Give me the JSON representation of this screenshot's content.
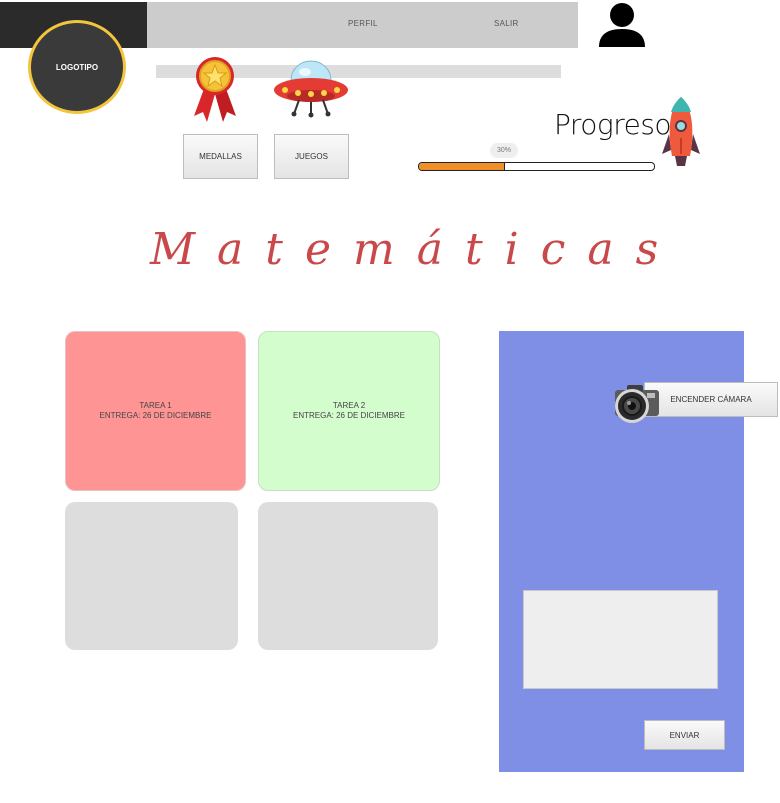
{
  "header": {
    "logo_text": "LOGOTIPO",
    "nav": {
      "profile": "PERFIL",
      "logout": "SALIR"
    }
  },
  "icons": {
    "user": "user-icon",
    "medal": "medal-icon",
    "ufo": "ufo-icon",
    "rocket": "rocket-icon",
    "camera": "camera-icon"
  },
  "buttons": {
    "medals": "MEDALLAS",
    "games": "JUEGOS"
  },
  "progress": {
    "title": "Progreso",
    "value_label": "30%",
    "value": 0.36
  },
  "subject": {
    "title": "Matemáticas"
  },
  "tasks": [
    {
      "title": "TAREA 1",
      "due": "ENTREGA: 26 DE DICIEMBRE",
      "color": "#ff9494"
    },
    {
      "title": "TAREA 2",
      "due": "ENTREGA: 26 DE DICIEMBRE",
      "color": "#d3fdcc"
    },
    {
      "title": "",
      "due": "",
      "color": "#dddddd"
    },
    {
      "title": "",
      "due": "",
      "color": "#dddddd"
    }
  ],
  "submission": {
    "camera_button": "ENCENDER CÁMARA",
    "send_button": "ENVIAR",
    "panel_color": "#7f8fe6"
  }
}
